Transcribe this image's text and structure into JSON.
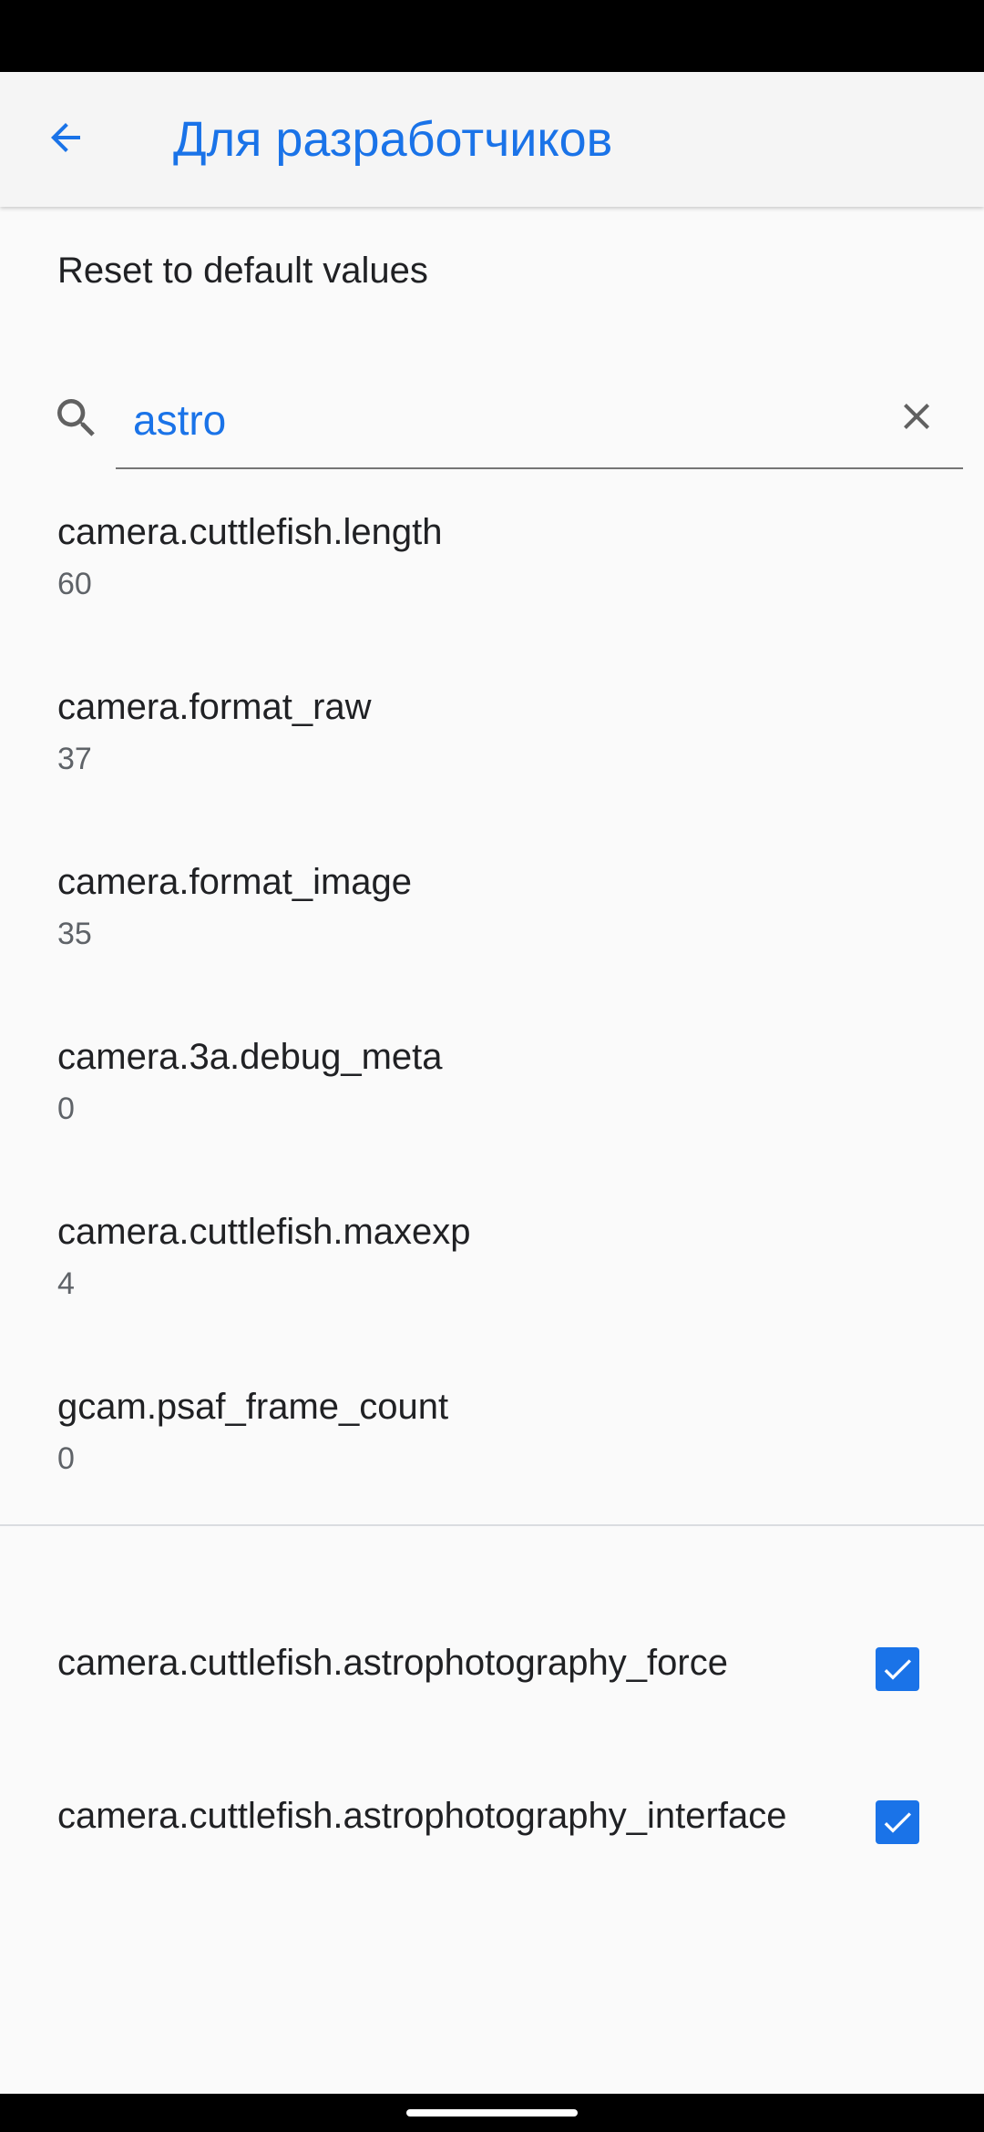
{
  "colors": {
    "accent": "#1a73e8",
    "text_primary": "#202124",
    "text_secondary": "#5f6368",
    "background": "#fafafa"
  },
  "app_bar": {
    "back_icon": "arrow-left-icon",
    "title": "Для разработчиков"
  },
  "reset": {
    "label": "Reset to default values"
  },
  "search": {
    "icon": "search-icon",
    "value": "astro",
    "clear_icon": "close-icon"
  },
  "items": [
    {
      "title": "camera.cuttlefish.length",
      "value": "60"
    },
    {
      "title": "camera.format_raw",
      "value": "37"
    },
    {
      "title": "camera.format_image",
      "value": "35"
    },
    {
      "title": "camera.3a.debug_meta",
      "value": "0"
    },
    {
      "title": "camera.cuttlefish.maxexp",
      "value": "4"
    },
    {
      "title": "gcam.psaf_frame_count",
      "value": "0"
    }
  ],
  "toggles": [
    {
      "label": "camera.cuttlefish.astrophotography_force",
      "checked": true
    },
    {
      "label": "camera.cuttlefish.astrophotography_interface",
      "checked": true
    }
  ]
}
